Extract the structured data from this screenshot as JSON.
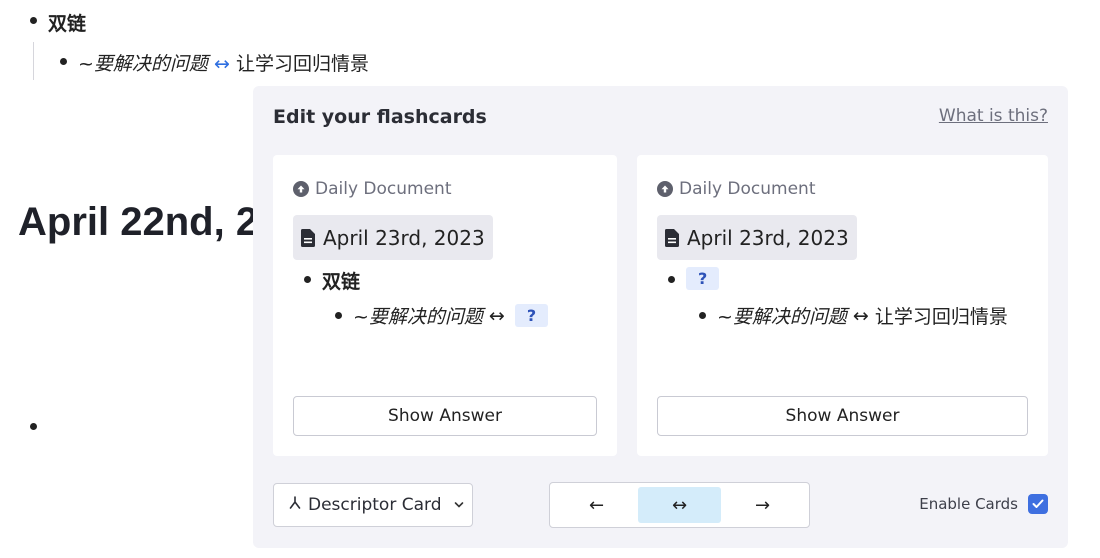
{
  "background": {
    "line1": "双链",
    "line2_italic": "~要解决的问题",
    "line2_arrow": "↔",
    "line2_rest": "让学习回归情景",
    "page_title": "April 22nd, 2"
  },
  "panel": {
    "title": "Edit your flashcards",
    "help_link": "What is this?",
    "cards": [
      {
        "breadcrumb": "Daily Document",
        "doc": "April 23rd, 2023",
        "line1": "双链",
        "line2_italic": "~要解决的问题",
        "line2_arrow": "↔",
        "line2_chip": "?",
        "button": "Show Answer"
      },
      {
        "breadcrumb": "Daily Document",
        "doc": "April 23rd, 2023",
        "line1_chip": "?",
        "line2_italic": "~要解决的问题",
        "line2_arrow": "↔",
        "line2_rest": "让学习回归情景",
        "button": "Show Answer"
      }
    ],
    "card_type_label": "Descriptor Card",
    "directions": [
      "←",
      "↔",
      "→"
    ],
    "selected_direction": "↔",
    "enable_label": "Enable Cards",
    "enable_checked": true
  },
  "colors": {
    "accent": "#3e6fe0",
    "selected_direction": "#d4ecfa",
    "panel_bg": "#f3f3f8",
    "link_arrow": "#2f6fe0"
  }
}
